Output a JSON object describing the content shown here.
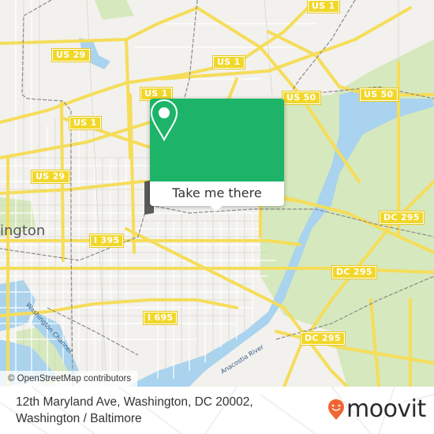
{
  "map": {
    "city_label": "ington",
    "water_labels": {
      "washington_channel": "Washington Channel",
      "anacostia_river": "Anacostia River"
    },
    "route_shields": [
      {
        "id": "us1-top",
        "label": "US 1"
      },
      {
        "id": "us29-top",
        "label": "US 29"
      },
      {
        "id": "us1-left",
        "label": "US 1"
      },
      {
        "id": "us1-mid",
        "label": "US 1"
      },
      {
        "id": "us1-upper",
        "label": "US 1"
      },
      {
        "id": "us50-left",
        "label": "US 50"
      },
      {
        "id": "us50-right",
        "label": "US 50"
      },
      {
        "id": "us29-left",
        "label": "US 29"
      },
      {
        "id": "i395",
        "label": "I 395"
      },
      {
        "id": "dc295-east",
        "label": "DC 295"
      },
      {
        "id": "dc295-mid",
        "label": "DC 295"
      },
      {
        "id": "i695",
        "label": "I 695"
      },
      {
        "id": "dc295-south",
        "label": "DC 295"
      }
    ],
    "attribution": "© OpenStreetMap contributors",
    "colors": {
      "land": "#f2f1ed",
      "road": "#f5dd5a",
      "water": "#a9d3ee",
      "park": "#d6e8bd",
      "rail": "#8a8a8a",
      "shield": "#f2d72a"
    }
  },
  "popup": {
    "icon": "map-pin-icon",
    "button_label": "Take me there",
    "accent_color": "#1db469"
  },
  "footer": {
    "address_line1": "12th Maryland Ave, Washington, DC 20002,",
    "address_line2": "Washington / Baltimore",
    "brand": {
      "icon": "moovit-logo-icon",
      "name": "moovit",
      "color": "#f26634"
    }
  }
}
